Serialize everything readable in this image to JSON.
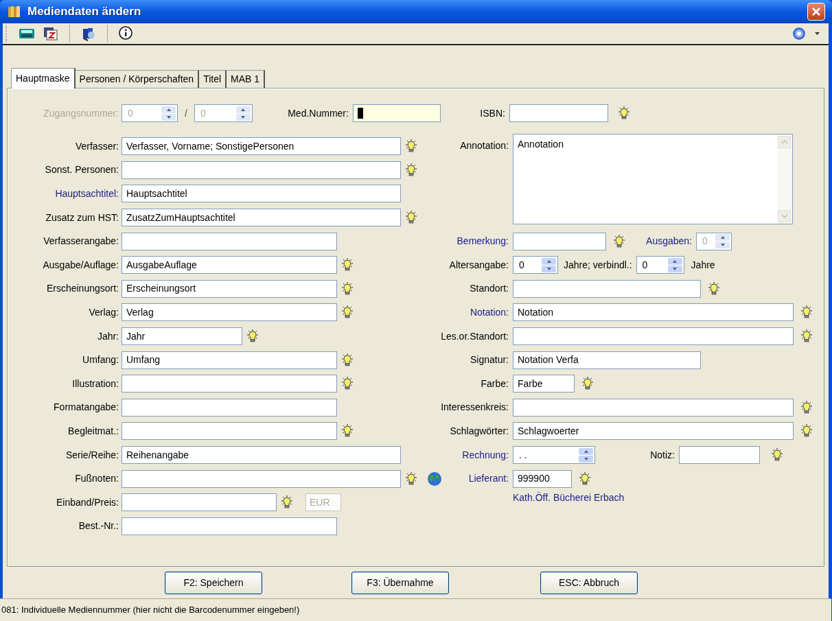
{
  "window": {
    "title": "Mediendaten ändern"
  },
  "tabs": [
    {
      "label": "Hauptmaske",
      "selected": true
    },
    {
      "label": "Personen / Körperschaften",
      "selected": false
    },
    {
      "label": "Titel",
      "selected": false
    },
    {
      "label": "MAB 1",
      "selected": false
    }
  ],
  "header": {
    "access": {
      "label": "Zugangsnummer:",
      "disabled": true,
      "value": "0",
      "separator": "/",
      "value2": "0"
    },
    "media_number": {
      "label": "Med.Nummer:",
      "focused": true
    },
    "isbn": {
      "label": "ISBN:",
      "lookup": true
    }
  },
  "left_fields": [
    {
      "label": "Verfasser:",
      "linked": false,
      "value": "Verfasser, Vorname; SonstigePersonen",
      "lookup": true
    },
    {
      "label": "Sonst. Personen:",
      "linked": false,
      "lookup": true
    },
    {
      "label": "Hauptsachtitel:",
      "linked": true,
      "value": "Hauptsachtitel",
      "lookup": false
    },
    {
      "label": "Zusatz zum HST:",
      "linked": false,
      "value": "ZusatzZumHauptsachtitel",
      "lookup": true
    },
    {
      "label": "Verfasserangabe:",
      "linked": false,
      "lookup": false
    },
    {
      "label": "Ausgabe/Auflage:",
      "linked": false,
      "value": "AusgabeAuflage",
      "lookup": true
    },
    {
      "label": "Erscheinungsort:",
      "linked": false,
      "value": "Erscheinungsort",
      "lookup": true
    },
    {
      "label": "Verlag:",
      "linked": false,
      "value": "Verlag",
      "lookup": true
    },
    {
      "label": "Jahr:",
      "linked": false,
      "value": "Jahr",
      "lookup": true
    },
    {
      "label": "Umfang:",
      "linked": false,
      "value": "Umfang",
      "lookup": true
    },
    {
      "label": "Illustration:",
      "linked": false,
      "lookup": true
    },
    {
      "label": "Formatangabe:",
      "linked": false,
      "lookup": false
    },
    {
      "label": "Begleitmat.:",
      "linked": false,
      "lookup": true
    },
    {
      "label": "Serie/Reihe:",
      "linked": false,
      "value": "Reihenangabe",
      "lookup": false
    },
    {
      "label": "Fußnoten:",
      "linked": false,
      "lookup": true
    },
    {
      "label": "Einband/Preis:",
      "linked": false,
      "lookup": true,
      "currency": "EUR"
    },
    {
      "label": "Best.-Nr.:",
      "linked": false,
      "lookup": false
    }
  ],
  "right_fields": [
    {
      "kind": "textarea",
      "label": "Annotation:",
      "linked": false,
      "value": "Annotation"
    },
    {
      "kind": "text",
      "label": "Bemerkung:",
      "linked": true,
      "lookup": true,
      "extra": {
        "label": "Ausgaben:",
        "linked": true,
        "value": "0",
        "disabled": true
      }
    },
    {
      "kind": "age",
      "label": "Altersangabe:",
      "linked": false,
      "value": "0",
      "unit": "Jahre; verbindl.:",
      "value2": "0",
      "unit2": "Jahre"
    },
    {
      "kind": "text",
      "label": "Standort:",
      "linked": false,
      "lookup": true
    },
    {
      "kind": "text",
      "label": "Notation:",
      "linked": true,
      "value": "Notation",
      "lookup": true
    },
    {
      "kind": "text",
      "label": "Les.or.Standort:",
      "linked": false,
      "lookup": true
    },
    {
      "kind": "text",
      "label": "Signatur:",
      "linked": false,
      "value": "Notation Verfa",
      "lookup": false
    },
    {
      "kind": "text",
      "label": "Farbe:",
      "linked": false,
      "value": "Farbe",
      "lookup": true
    },
    {
      "kind": "text",
      "label": "Interessenkreis:",
      "linked": false,
      "lookup": true
    },
    {
      "kind": "text",
      "label": "Schlagwörter:",
      "linked": false,
      "value": "Schlagwoerter",
      "lookup": true
    },
    {
      "kind": "date",
      "label": "Rechnung:",
      "linked": true,
      "value": ". .",
      "note_label": "Notiz:",
      "lookup": true
    },
    {
      "kind": "supplier",
      "label": "Lieferant:",
      "linked": true,
      "value": "999900",
      "lookup": true
    },
    {
      "kind": "caption",
      "value": "Kath.Öff. Bücherei Erbach"
    }
  ],
  "buttons": [
    "F2: Speichern",
    "F3: Übernahme",
    "ESC: Abbruch"
  ],
  "status_bar": "081: Individuelle Mediennummer (hier nicht die Barcodenummer eingeben!)"
}
